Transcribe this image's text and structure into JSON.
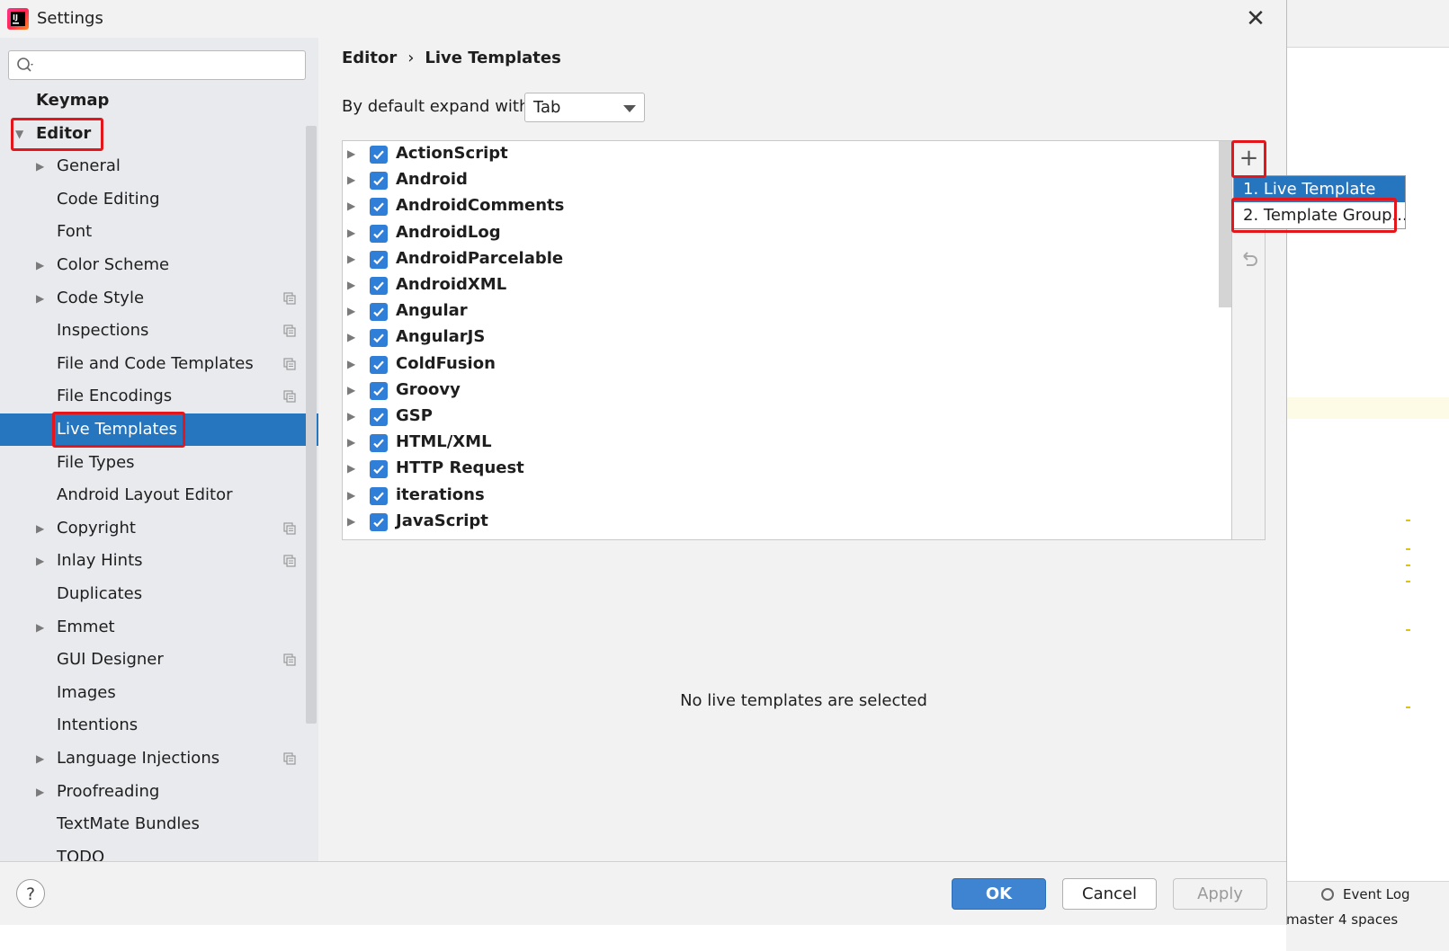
{
  "window": {
    "title": "Settings"
  },
  "search": {
    "placeholder": ""
  },
  "sidebar": {
    "items": [
      {
        "label": "Keymap",
        "level": 0,
        "expandable": false,
        "bold": true,
        "selected": false,
        "copy_icon": false
      },
      {
        "label": "Editor",
        "level": 0,
        "expandable": true,
        "expanded": true,
        "bold": true,
        "selected": false,
        "copy_icon": false
      },
      {
        "label": "General",
        "level": 1,
        "expandable": true,
        "selected": false,
        "copy_icon": false
      },
      {
        "label": "Code Editing",
        "level": 1,
        "expandable": false,
        "selected": false,
        "copy_icon": false
      },
      {
        "label": "Font",
        "level": 1,
        "expandable": false,
        "selected": false,
        "copy_icon": false
      },
      {
        "label": "Color Scheme",
        "level": 1,
        "expandable": true,
        "selected": false,
        "copy_icon": false
      },
      {
        "label": "Code Style",
        "level": 1,
        "expandable": true,
        "selected": false,
        "copy_icon": true
      },
      {
        "label": "Inspections",
        "level": 1,
        "expandable": false,
        "selected": false,
        "copy_icon": true
      },
      {
        "label": "File and Code Templates",
        "level": 1,
        "expandable": false,
        "selected": false,
        "copy_icon": true
      },
      {
        "label": "File Encodings",
        "level": 1,
        "expandable": false,
        "selected": false,
        "copy_icon": true
      },
      {
        "label": "Live Templates",
        "level": 1,
        "expandable": false,
        "selected": true,
        "copy_icon": false
      },
      {
        "label": "File Types",
        "level": 1,
        "expandable": false,
        "selected": false,
        "copy_icon": false
      },
      {
        "label": "Android Layout Editor",
        "level": 1,
        "expandable": false,
        "selected": false,
        "copy_icon": false
      },
      {
        "label": "Copyright",
        "level": 1,
        "expandable": true,
        "selected": false,
        "copy_icon": true
      },
      {
        "label": "Inlay Hints",
        "level": 1,
        "expandable": true,
        "selected": false,
        "copy_icon": true
      },
      {
        "label": "Duplicates",
        "level": 1,
        "expandable": false,
        "selected": false,
        "copy_icon": false
      },
      {
        "label": "Emmet",
        "level": 1,
        "expandable": true,
        "selected": false,
        "copy_icon": false
      },
      {
        "label": "GUI Designer",
        "level": 1,
        "expandable": false,
        "selected": false,
        "copy_icon": true
      },
      {
        "label": "Images",
        "level": 1,
        "expandable": false,
        "selected": false,
        "copy_icon": false
      },
      {
        "label": "Intentions",
        "level": 1,
        "expandable": false,
        "selected": false,
        "copy_icon": false
      },
      {
        "label": "Language Injections",
        "level": 1,
        "expandable": true,
        "selected": false,
        "copy_icon": true
      },
      {
        "label": "Proofreading",
        "level": 1,
        "expandable": true,
        "selected": false,
        "copy_icon": false
      },
      {
        "label": "TextMate Bundles",
        "level": 1,
        "expandable": false,
        "selected": false,
        "copy_icon": false
      },
      {
        "label": "TODO",
        "level": 1,
        "expandable": false,
        "selected": false,
        "copy_icon": false
      }
    ]
  },
  "breadcrumb": {
    "parent": "Editor",
    "separator": "›",
    "current": "Live Templates"
  },
  "expand": {
    "label": "By default expand with",
    "value": "Tab"
  },
  "templates": [
    {
      "name": "ActionScript",
      "checked": true
    },
    {
      "name": "Android",
      "checked": true
    },
    {
      "name": "AndroidComments",
      "checked": true
    },
    {
      "name": "AndroidLog",
      "checked": true
    },
    {
      "name": "AndroidParcelable",
      "checked": true
    },
    {
      "name": "AndroidXML",
      "checked": true
    },
    {
      "name": "Angular",
      "checked": true
    },
    {
      "name": "AngularJS",
      "checked": true
    },
    {
      "name": "ColdFusion",
      "checked": true
    },
    {
      "name": "Groovy",
      "checked": true
    },
    {
      "name": "GSP",
      "checked": true
    },
    {
      "name": "HTML/XML",
      "checked": true
    },
    {
      "name": "HTTP Request",
      "checked": true
    },
    {
      "name": "iterations",
      "checked": true
    },
    {
      "name": "JavaScript",
      "checked": true
    }
  ],
  "popup_menu": {
    "items": [
      {
        "label": "1. Live Template",
        "active": true
      },
      {
        "label": "2. Template Group...",
        "active": false
      }
    ]
  },
  "empty_message": "No live templates are selected",
  "buttons": {
    "ok": "OK",
    "cancel": "Cancel",
    "apply": "Apply",
    "help": "?"
  },
  "background_ide": {
    "event_log": "Event Log",
    "status_branch": "master",
    "status_indent": "4 spaces"
  },
  "colors": {
    "accent": "#2675bf",
    "annotation": "#e5151c",
    "checkbox": "#2f7ed8"
  }
}
